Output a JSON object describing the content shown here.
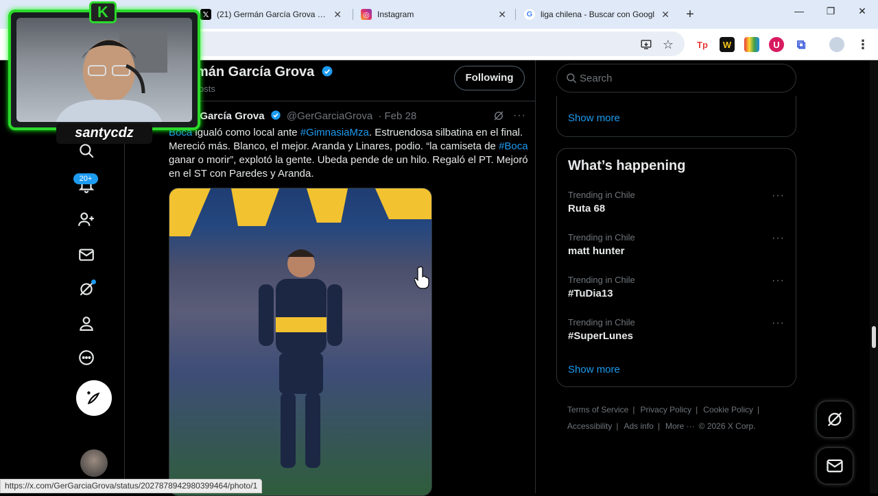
{
  "browser": {
    "tabs": [
      {
        "favicon": "x-logo",
        "title": "(21) Germán García Grova (@Ge",
        "close": "✕"
      },
      {
        "favicon": "instagram-logo",
        "title": "Instagram",
        "close": "✕"
      },
      {
        "favicon": "google-logo",
        "title": "liga chilena - Buscar con Googl",
        "close": "✕"
      }
    ],
    "new_tab": "+",
    "status_url": "https://x.com/GerGarciaGrova/status/2027878942980399464/photo/1"
  },
  "overlay": {
    "badge": "K",
    "streamer_name": "santycdz"
  },
  "nav": {
    "notification_count": "20+",
    "icons": [
      "search-icon",
      "notifications-icon",
      "follow-icon",
      "messages-icon",
      "grok-icon",
      "profile-icon",
      "more-icon"
    ]
  },
  "profile": {
    "name": "mán García Grova",
    "posts_label": "osts",
    "follow_label": "Following"
  },
  "tweet": {
    "author": "n García Grova",
    "handle": "@GerGarciaGrova",
    "date": "· Feb 28",
    "text_parts": [
      {
        "t": "Boca",
        "link": true
      },
      {
        "t": " igualó como local ante ",
        "link": false
      },
      {
        "t": "#GimnasiaMza",
        "link": true
      },
      {
        "t": ". Estruendosa silbatina en el final. Mereció más. Blanco, el mejor. Aranda y Linares, podio. “la camiseta de ",
        "link": false
      },
      {
        "t": "#Boca",
        "link": true
      },
      {
        "t": " ganar o morir”, explotó la gente. Ubeda pende de un hilo. Regaló el PT. Mejoró en el ST con Paredes y Aranda.",
        "link": false
      }
    ]
  },
  "sidebar": {
    "search_placeholder": "Search",
    "show_more_1": "Show more",
    "whats_happening": "What’s happening",
    "trends": [
      {
        "context": "Trending in Chile",
        "name": "Ruta 68"
      },
      {
        "context": "Trending in Chile",
        "name": "matt hunter"
      },
      {
        "context": "Trending in Chile",
        "name": "#TuDia13"
      },
      {
        "context": "Trending in Chile",
        "name": "#SuperLunes"
      }
    ],
    "show_more_2": "Show more",
    "footer": {
      "terms": "Terms of Service",
      "privacy": "Privacy Policy",
      "cookie": "Cookie Policy",
      "accessibility": "Accessibility",
      "ads": "Ads info",
      "more": "More ···",
      "copyright": "© 2026 X Corp."
    }
  },
  "colors": {
    "accent": "#1d9bf0",
    "background": "#000000",
    "overlay_green": "#2bd92b"
  }
}
